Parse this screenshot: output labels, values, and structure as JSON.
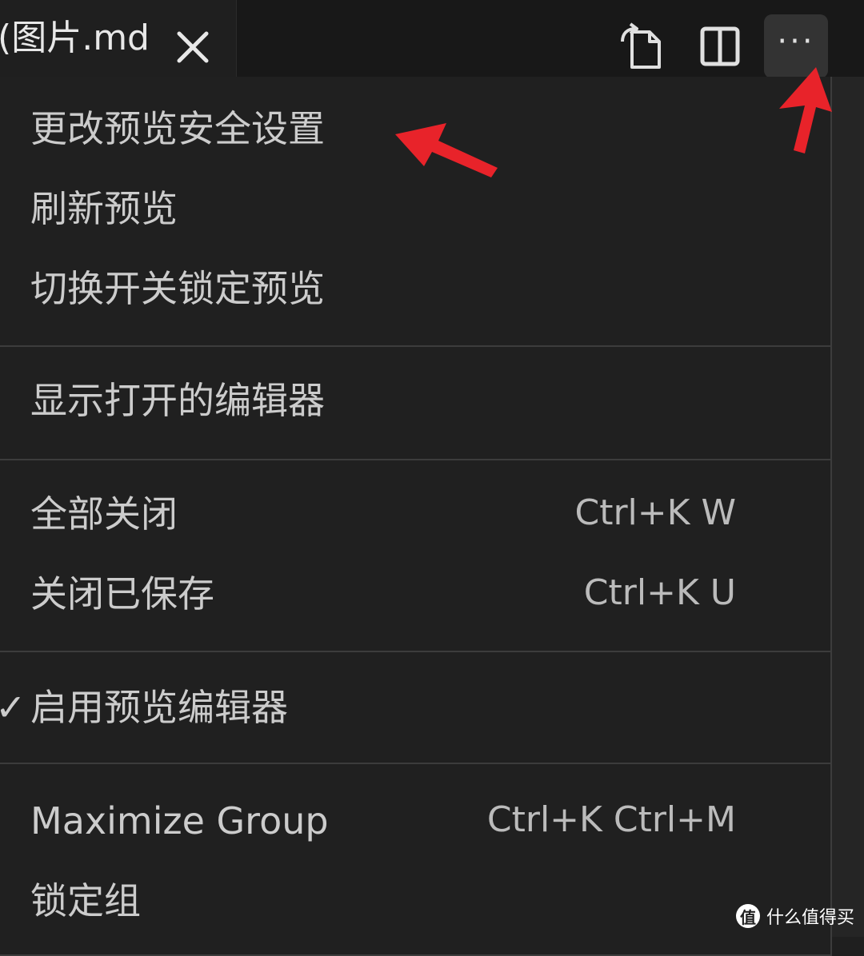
{
  "tab": {
    "title": "(图片.md",
    "close_icon": "close-icon"
  },
  "tab_actions": {
    "open_source_icon": "open-file-icon",
    "split_icon": "split-editor-icon",
    "more_label": "···"
  },
  "menu": {
    "groups": [
      [
        {
          "label": "更改预览安全设置",
          "shortcut": ""
        },
        {
          "label": "刷新预览",
          "shortcut": ""
        },
        {
          "label": "切换开关锁定预览",
          "shortcut": ""
        }
      ],
      [
        {
          "label": "显示打开的编辑器",
          "shortcut": ""
        }
      ],
      [
        {
          "label": "全部关闭",
          "shortcut": "Ctrl+K W"
        },
        {
          "label": "关闭已保存",
          "shortcut": "Ctrl+K U"
        }
      ],
      [
        {
          "label": "启用预览编辑器",
          "shortcut": "",
          "checked": true,
          "check_mark": "✓"
        }
      ],
      [
        {
          "label": "Maximize Group",
          "shortcut": "Ctrl+K Ctrl+M"
        },
        {
          "label": "锁定组",
          "shortcut": ""
        }
      ]
    ]
  },
  "annotation_color": "#e8232a",
  "watermark": {
    "badge": "值",
    "text": "什么值得买"
  }
}
